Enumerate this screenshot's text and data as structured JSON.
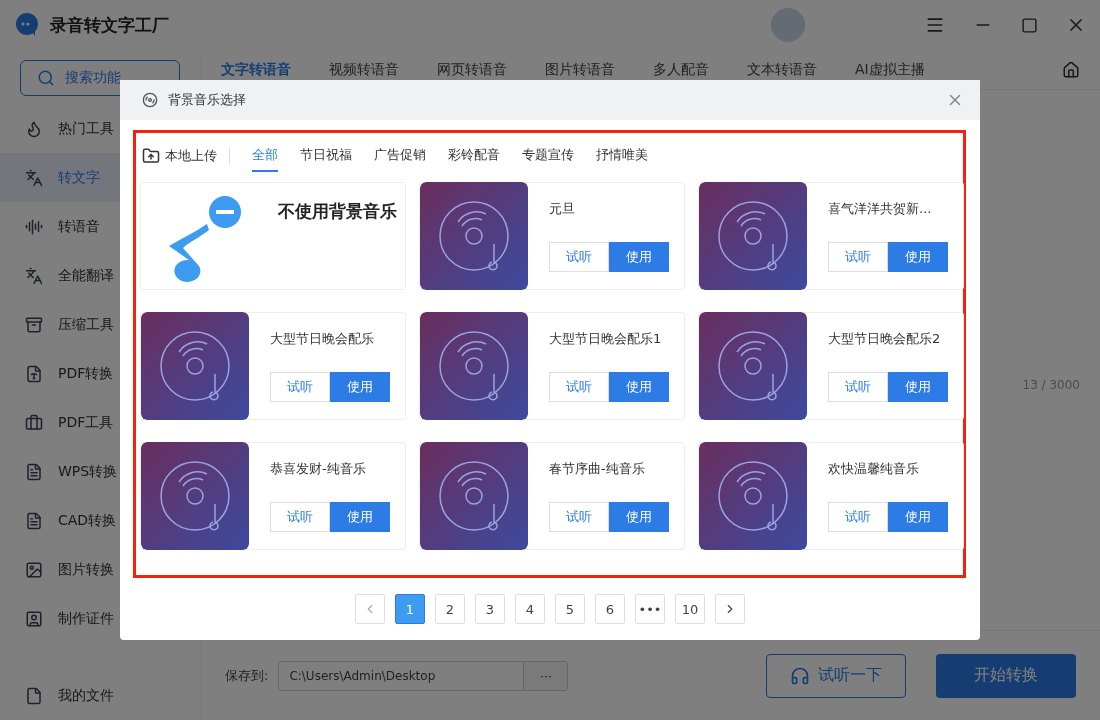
{
  "app": {
    "title": "录音转文字工厂"
  },
  "sidebar": {
    "search": "搜索功能",
    "items": [
      {
        "label": "热门工具",
        "selected": false
      },
      {
        "label": "转文字",
        "selected": true
      },
      {
        "label": "转语音",
        "selected": false
      },
      {
        "label": "全能翻译",
        "selected": false
      },
      {
        "label": "压缩工具",
        "selected": false
      },
      {
        "label": "PDF转换",
        "selected": false
      },
      {
        "label": "PDF工具",
        "selected": false
      },
      {
        "label": "WPS转换",
        "selected": false
      },
      {
        "label": "CAD转换",
        "selected": false
      },
      {
        "label": "图片转换",
        "selected": false
      },
      {
        "label": "制作证件",
        "selected": false
      }
    ],
    "footer": "我的文件"
  },
  "top_tabs": [
    {
      "label": "文字转语音",
      "selected": true
    },
    {
      "label": "视频转语音",
      "selected": false
    },
    {
      "label": "网页转语音",
      "selected": false
    },
    {
      "label": "图片转语音",
      "selected": false
    },
    {
      "label": "多人配音",
      "selected": false
    },
    {
      "label": "文本转语音",
      "selected": false
    },
    {
      "label": "AI虚拟主播",
      "selected": false
    }
  ],
  "char_count": "13 / 3000",
  "save": {
    "label": "保存到:",
    "path": "C:\\Users\\Admin\\Desktop",
    "browse": "···"
  },
  "actions": {
    "preview": "试听一下",
    "start": "开始转换"
  },
  "dialog": {
    "title": "背景音乐选择",
    "upload": "本地上传",
    "categories": [
      {
        "label": "全部",
        "selected": true
      },
      {
        "label": "节日祝福",
        "selected": false
      },
      {
        "label": "广告促销",
        "selected": false
      },
      {
        "label": "彩铃配音",
        "selected": false
      },
      {
        "label": "专题宣传",
        "selected": false
      },
      {
        "label": "抒情唯美",
        "selected": false
      }
    ],
    "tracks": [
      {
        "kind": "none",
        "name": "不使用背景音乐"
      },
      {
        "kind": "track",
        "name": "元旦",
        "listen": "试听",
        "use": "使用"
      },
      {
        "kind": "track",
        "name": "喜气洋洋共贺新...",
        "listen": "试听",
        "use": "使用"
      },
      {
        "kind": "track",
        "name": "大型节日晚会配乐",
        "listen": "试听",
        "use": "使用"
      },
      {
        "kind": "track",
        "name": "大型节日晚会配乐1",
        "listen": "试听",
        "use": "使用"
      },
      {
        "kind": "track",
        "name": "大型节日晚会配乐2",
        "listen": "试听",
        "use": "使用"
      },
      {
        "kind": "track",
        "name": "恭喜发财-纯音乐",
        "listen": "试听",
        "use": "使用"
      },
      {
        "kind": "track",
        "name": "春节序曲-纯音乐",
        "listen": "试听",
        "use": "使用"
      },
      {
        "kind": "track",
        "name": "欢快温馨纯音乐",
        "listen": "试听",
        "use": "使用"
      }
    ],
    "pages": [
      {
        "label": "1",
        "selected": true
      },
      {
        "label": "2",
        "selected": false
      },
      {
        "label": "3",
        "selected": false
      },
      {
        "label": "4",
        "selected": false
      },
      {
        "label": "5",
        "selected": false
      },
      {
        "label": "6",
        "selected": false
      },
      {
        "label": "•••",
        "selected": false
      },
      {
        "label": "10",
        "selected": false
      }
    ]
  }
}
